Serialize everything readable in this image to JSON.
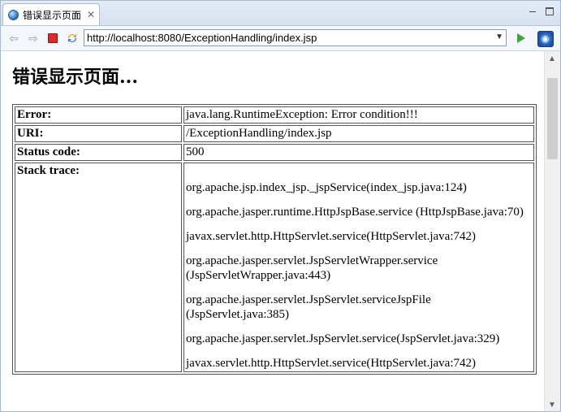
{
  "tab": {
    "title": "错误显示页面",
    "close_symbol": "✕"
  },
  "toolbar": {
    "back_symbol": "⇦",
    "forward_symbol": "⇨",
    "url": "http://localhost:8080/ExceptionHandling/index.jsp"
  },
  "page": {
    "title": "错误显示页面...",
    "rows": [
      {
        "label": "Error:",
        "value": "java.lang.RuntimeException: Error condition!!!"
      },
      {
        "label": "URI:",
        "value": "/ExceptionHandling/index.jsp"
      },
      {
        "label": "Status code:",
        "value": "500"
      }
    ],
    "stack_label": "Stack trace:",
    "stack_lines": [
      "org.apache.jsp.index_jsp._jspService(index_jsp.java:124)",
      "org.apache.jasper.runtime.HttpJspBase.service (HttpJspBase.java:70)",
      "javax.servlet.http.HttpServlet.service(HttpServlet.java:742)",
      "org.apache.jasper.servlet.JspServletWrapper.service (JspServletWrapper.java:443)",
      "org.apache.jasper.servlet.JspServlet.serviceJspFile (JspServlet.java:385)",
      "org.apache.jasper.servlet.JspServlet.service(JspServlet.java:329)",
      "javax.servlet.http.HttpServlet.service(HttpServlet.java:742)"
    ]
  },
  "icons": {
    "tab": "globe-icon",
    "back": "back-arrow-icon",
    "forward": "forward-arrow-icon",
    "stop": "stop-icon",
    "refresh": "refresh-icon",
    "go": "go-icon",
    "browser": "browser-globe-icon"
  }
}
